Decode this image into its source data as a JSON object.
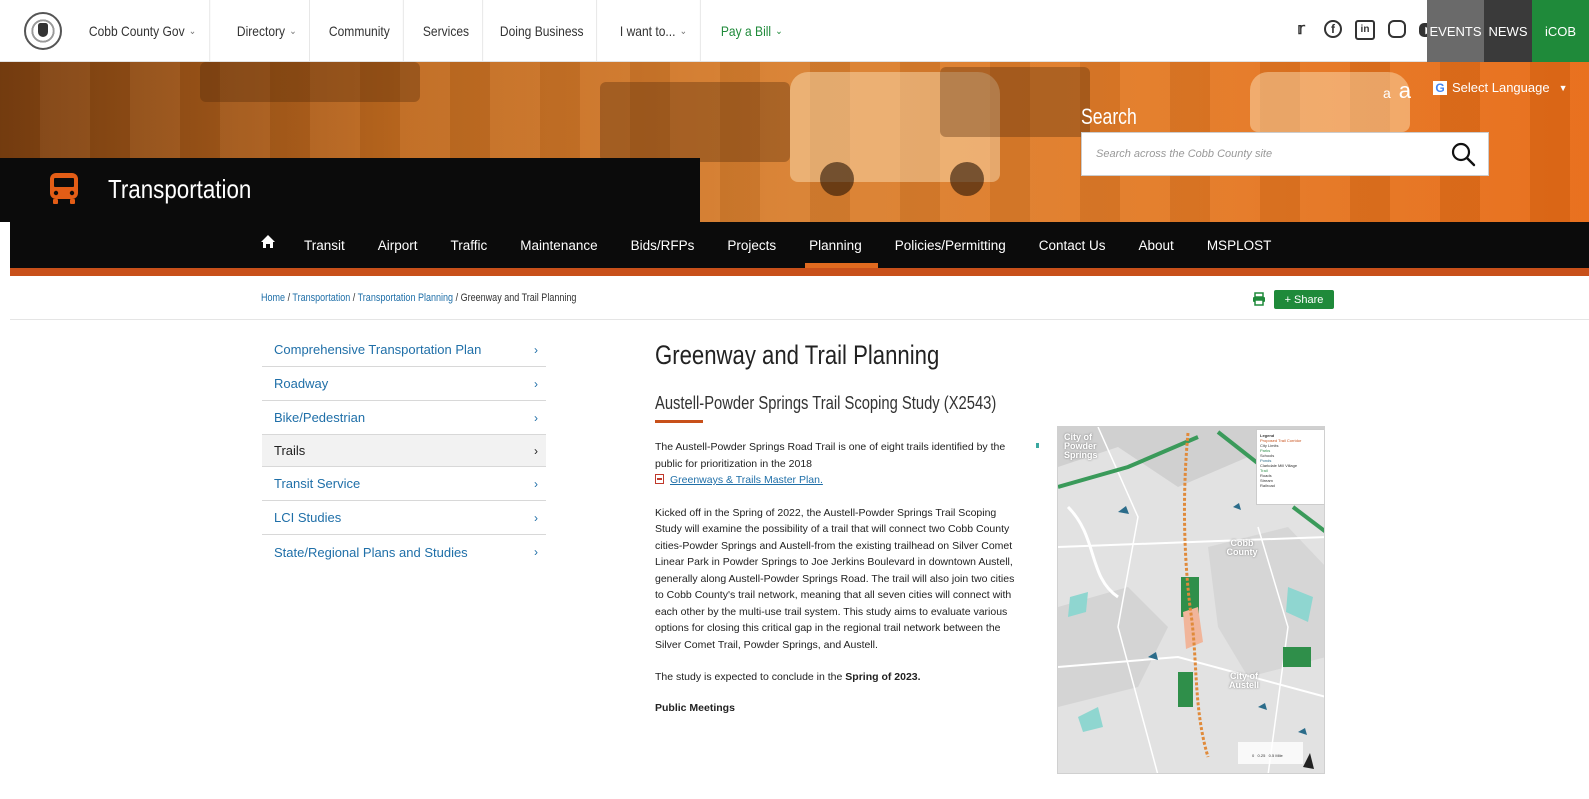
{
  "site": {
    "top_nav": [
      {
        "label": "Cobb County Gov",
        "dropdown": true
      },
      {
        "label": "Directory",
        "dropdown": true
      },
      {
        "label": "Community",
        "dropdown": false
      },
      {
        "label": "Services",
        "dropdown": false
      },
      {
        "label": "Doing Business",
        "dropdown": false
      },
      {
        "label": "I want to...",
        "dropdown": true
      },
      {
        "label": "Pay a Bill",
        "dropdown": true
      }
    ],
    "social_icons": [
      "twitter-icon",
      "facebook-icon",
      "linkedin-icon",
      "instagram-icon",
      "youtube-icon"
    ],
    "top_tabs": {
      "events": "EVENTS",
      "news": "NEWS",
      "icob": "iCOB"
    },
    "colors": {
      "accent_orange": "#c8501a",
      "green": "#1f8a3a",
      "link_blue": "#1f6fa8",
      "black": "#0b0b0b"
    }
  },
  "hero": {
    "department": "Transportation",
    "search_label": "Search",
    "search_placeholder": "Search across the Cobb County site",
    "font_small": "a",
    "font_large": "a",
    "language": "Select Language"
  },
  "main_nav": {
    "items": [
      "Transit",
      "Airport",
      "Traffic",
      "Maintenance",
      "Bids/RFPs",
      "Projects",
      "Planning",
      "Policies/Permitting",
      "Contact Us",
      "About",
      "MSPLOST"
    ],
    "active": "Planning"
  },
  "breadcrumb": {
    "home": "Home",
    "sep": " / ",
    "level1": "Transportation",
    "level2": "Transportation Planning",
    "current": "Greenway and Trail Planning"
  },
  "share_label": "+ Share",
  "side_nav": [
    {
      "label": "Comprehensive Transportation Plan",
      "active": false
    },
    {
      "label": "Roadway",
      "active": false
    },
    {
      "label": "Bike/Pedestrian",
      "active": false
    },
    {
      "label": "Trails",
      "active": true
    },
    {
      "label": "Transit Service",
      "active": false
    },
    {
      "label": "LCI Studies",
      "active": false
    },
    {
      "label": "State/Regional Plans and Studies",
      "active": false
    }
  ],
  "content": {
    "title": "Greenway and Trail Planning",
    "subtitle": "Austell-Powder Springs Trail Scoping Study (X2543)",
    "para1": "The Austell-Powder Springs Road Trail is one of eight trails identified by the public for prioritization in the 2018",
    "link_master_plan": "Greenways & Trails Master Plan.",
    "para2": "Kicked off in the Spring of 2022, the Austell-Powder Springs Trail Scoping Study will examine the possibility of a trail that will connect two Cobb County cities-Powder Springs and Austell-from the existing trailhead on Silver Comet Linear Park in Powder Springs to Joe Jerkins Boulevard in downtown Austell, generally along Austell-Powder Springs Road. The trail will also join two cities to Cobb County's trail network, meaning that all seven cities will connect with each other by the multi-use trail system.  This study aims to evaluate various options for closing this critical gap in the regional trail network between the Silver Comet Trail, Powder Springs, and Austell.",
    "para3_prefix": "The study is expected to conclude in the ",
    "para3_bold": "Spring of 2023.",
    "public_meetings": "Public Meetings"
  },
  "map": {
    "labels": {
      "powder_springs": "City of Powder Springs",
      "cobb": "Cobb County",
      "austell": "City of Austell"
    },
    "legend_title": "Legend",
    "legend_items": [
      "Proposed Trail Corridor",
      "City Limits",
      "Parks",
      "Schools",
      "Ponds",
      "Clarkdale Mill Village",
      "Trail",
      "Roads",
      "Stream",
      "Railroad"
    ],
    "scale_text": "0   0.25   0.5 Mile"
  }
}
